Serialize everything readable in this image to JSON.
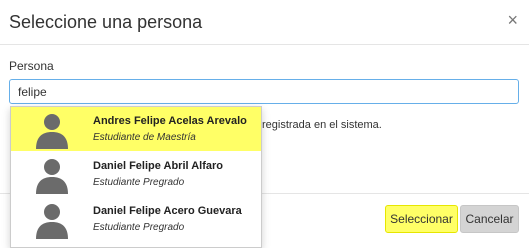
{
  "modal": {
    "title": "Seleccione una persona",
    "close_glyph": "×"
  },
  "form": {
    "label": "Persona",
    "input_value": "felipe",
    "hidden_message_fragment": "registrada en el sistema."
  },
  "results": [
    {
      "name": "Andres Felipe Acelas Arevalo",
      "role": "Estudiante de Maestría",
      "highlighted": true,
      "icon": "user-silhouette-icon"
    },
    {
      "name": "Daniel Felipe Abril Alfaro",
      "role": "Estudiante Pregrado",
      "highlighted": false,
      "icon": "user-silhouette-icon"
    },
    {
      "name": "Daniel Felipe Acero Guevara",
      "role": "Estudiante Pregrado",
      "highlighted": false,
      "icon": "user-silhouette-icon"
    }
  ],
  "footer": {
    "select_label": "Seleccionar",
    "cancel_label": "Cancelar"
  },
  "colors": {
    "highlight": "#ffff66",
    "focus_border": "#66afe9",
    "cancel_bg": "#d4d4d4"
  }
}
